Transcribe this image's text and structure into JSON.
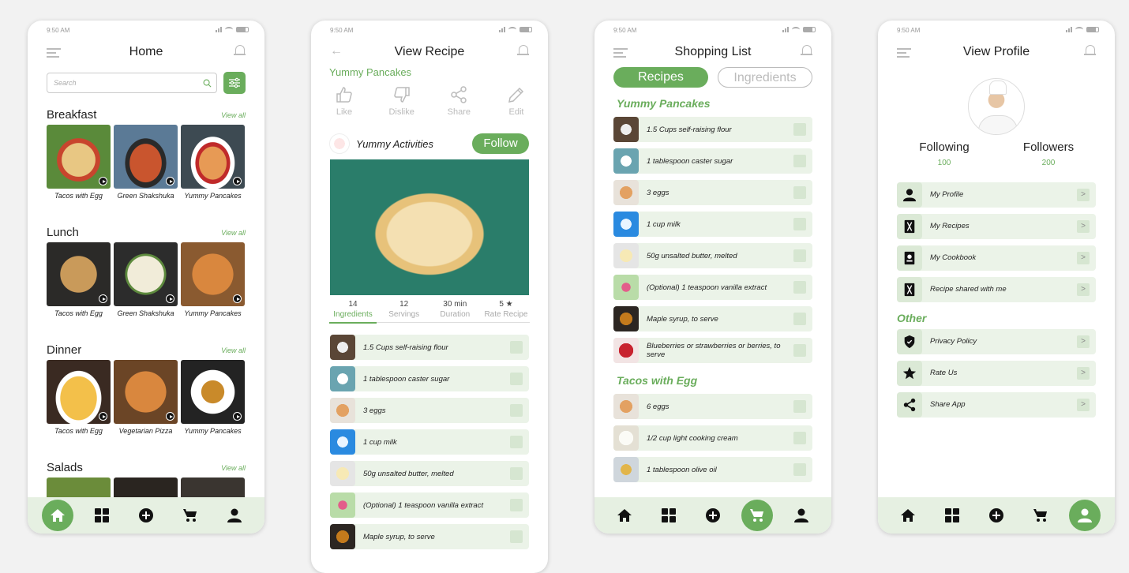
{
  "status_time": "9:50 AM",
  "home": {
    "title": "Home",
    "search_placeholder": "Search",
    "view_all": "View all",
    "sections": [
      {
        "title": "Breakfast",
        "items": [
          "Tacos with Egg",
          "Green Shakshuka",
          "Yummy Pancakes"
        ]
      },
      {
        "title": "Lunch",
        "items": [
          "Tacos with Egg",
          "Green Shakshuka",
          "Yummy Pancakes"
        ]
      },
      {
        "title": "Dinner",
        "items": [
          "Tacos with Egg",
          "Vegetarian Pizza",
          "Yummy Pancakes"
        ]
      },
      {
        "title": "Salads",
        "items": []
      }
    ]
  },
  "recipe": {
    "title": "View Recipe",
    "recipe_name": "Yummy Pancakes",
    "actions": [
      "Like",
      "Dislike",
      "Share",
      "Edit"
    ],
    "author": "Yummy Activities",
    "follow": "Follow",
    "stats": [
      {
        "value": "14",
        "label": "Ingredients"
      },
      {
        "value": "12",
        "label": "Servings"
      },
      {
        "value": "30 min",
        "label": "Duration"
      },
      {
        "value": "5 ★",
        "label": "Rate Recipe"
      }
    ],
    "ingredients": [
      "1.5 Cups self-raising flour",
      "1 tablespoon caster sugar",
      "3 eggs",
      "1 cup milk",
      "50g unsalted butter, melted",
      "(Optional) 1 teaspoon vanilla extract",
      "Maple syrup, to serve"
    ]
  },
  "shopping": {
    "title": "Shopping List",
    "tabs": [
      "Recipes",
      "Ingredients"
    ],
    "groups": [
      {
        "name": "Yummy Pancakes",
        "items": [
          "1.5 Cups self-raising flour",
          "1 tablespoon caster sugar",
          "3 eggs",
          "1 cup milk",
          "50g unsalted butter, melted",
          "(Optional) 1 teaspoon vanilla extract",
          "Maple syrup, to serve",
          "Blueberries or strawberries or berries, to serve"
        ]
      },
      {
        "name": "Tacos with Egg",
        "items": [
          "6 eggs",
          "1/2 cup light cooking cream",
          "1 tablespoon olive oil"
        ]
      }
    ]
  },
  "profile": {
    "title": "View Profile",
    "following_label": "Following",
    "following": "100",
    "followers_label": "Followers",
    "followers": "200",
    "menu": [
      "My Profile",
      "My Recipes",
      "My Cookbook",
      "Recipe shared with me"
    ],
    "other_label": "Other",
    "other": [
      "Privacy Policy",
      "Rate Us",
      "Share App"
    ]
  },
  "colors": {
    "accent": "#6aad5c",
    "row_bg": "#ebf3e8",
    "navbar_bg": "#e6f0e2"
  },
  "icons": [
    "home-icon",
    "grid-icon",
    "add-icon",
    "cart-icon",
    "user-icon"
  ]
}
